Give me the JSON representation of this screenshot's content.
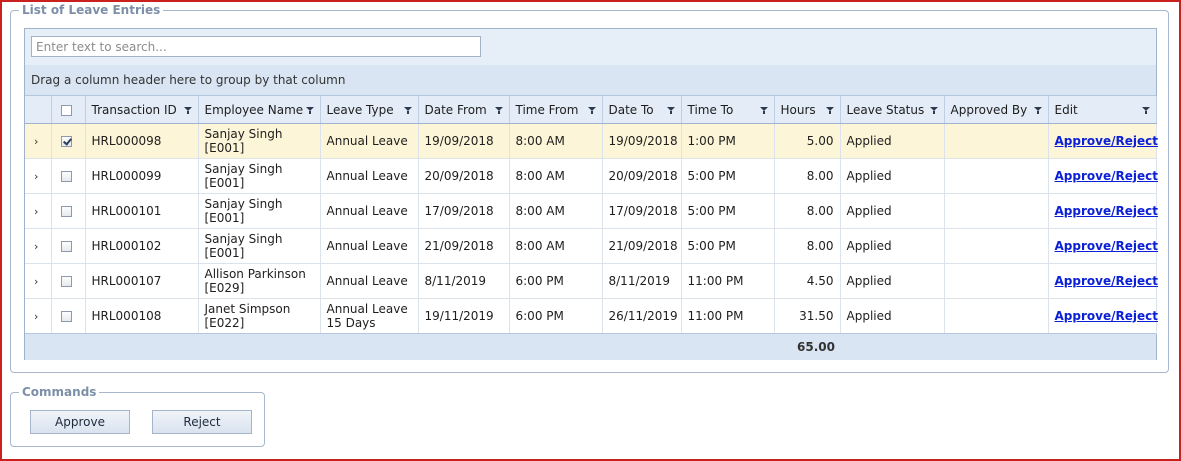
{
  "entries_section": {
    "legend": "List of Leave Entries"
  },
  "search": {
    "placeholder": "Enter text to search..."
  },
  "group_panel": {
    "text": "Drag a column header here to group by that column"
  },
  "columns": {
    "transaction_id": "Transaction ID",
    "employee_name": "Employee Name",
    "leave_type": "Leave Type",
    "date_from": "Date From",
    "time_from": "Time From",
    "date_to": "Date To",
    "time_to": "Time To",
    "hours": "Hours",
    "leave_status": "Leave Status",
    "approved_by": "Approved By",
    "edit": "Edit"
  },
  "rows": [
    {
      "selected": true,
      "id": "HRL000098",
      "name": "Sanjay Singh",
      "code": "[E001]",
      "leave_type": "Annual Leave",
      "leave_type_extra": "",
      "date_from": "19/09/2018",
      "time_from": "8:00 AM",
      "date_to": "19/09/2018",
      "time_to": "1:00 PM",
      "hours": "5.00",
      "status": "Applied",
      "approved_by": "",
      "action": "Approve/Reject"
    },
    {
      "selected": false,
      "id": "HRL000099",
      "name": "Sanjay Singh",
      "code": "[E001]",
      "leave_type": "Annual Leave",
      "leave_type_extra": "",
      "date_from": "20/09/2018",
      "time_from": "8:00 AM",
      "date_to": "20/09/2018",
      "time_to": "5:00 PM",
      "hours": "8.00",
      "status": "Applied",
      "approved_by": "",
      "action": "Approve/Reject"
    },
    {
      "selected": false,
      "id": "HRL000101",
      "name": "Sanjay Singh",
      "code": "[E001]",
      "leave_type": "Annual Leave",
      "leave_type_extra": "",
      "date_from": "17/09/2018",
      "time_from": "8:00 AM",
      "date_to": "17/09/2018",
      "time_to": "5:00 PM",
      "hours": "8.00",
      "status": "Applied",
      "approved_by": "",
      "action": "Approve/Reject"
    },
    {
      "selected": false,
      "id": "HRL000102",
      "name": "Sanjay Singh",
      "code": "[E001]",
      "leave_type": "Annual Leave",
      "leave_type_extra": "",
      "date_from": "21/09/2018",
      "time_from": "8:00 AM",
      "date_to": "21/09/2018",
      "time_to": "5:00 PM",
      "hours": "8.00",
      "status": "Applied",
      "approved_by": "",
      "action": "Approve/Reject"
    },
    {
      "selected": false,
      "id": "HRL000107",
      "name": "Allison Parkinson",
      "code": "[E029]",
      "leave_type": "Annual Leave",
      "leave_type_extra": "",
      "date_from": "8/11/2019",
      "time_from": "6:00 PM",
      "date_to": "8/11/2019",
      "time_to": "11:00 PM",
      "hours": "4.50",
      "status": "Applied",
      "approved_by": "",
      "action": "Approve/Reject"
    },
    {
      "selected": false,
      "id": "HRL000108",
      "name": "Janet Simpson",
      "code": "[E022]",
      "leave_type": "Annual Leave",
      "leave_type_extra": "15 Days",
      "date_from": "19/11/2019",
      "time_from": "6:00 PM",
      "date_to": "26/11/2019",
      "time_to": "11:00 PM",
      "hours": "31.50",
      "status": "Applied",
      "approved_by": "",
      "action": "Approve/Reject"
    }
  ],
  "footer": {
    "total_hours": "65.00"
  },
  "commands_section": {
    "legend": "Commands"
  },
  "buttons": {
    "approve": "Approve",
    "reject": "Reject"
  },
  "colors": {
    "frame_border": "#c9211e",
    "selected_row": "#fdf5d8",
    "link": "#0a1fd6",
    "header_bg": "#e3ecf7"
  },
  "icons": {
    "expand": "chevron-right-icon",
    "filter": "filter-icon",
    "checkbox": "checkbox-icon"
  }
}
